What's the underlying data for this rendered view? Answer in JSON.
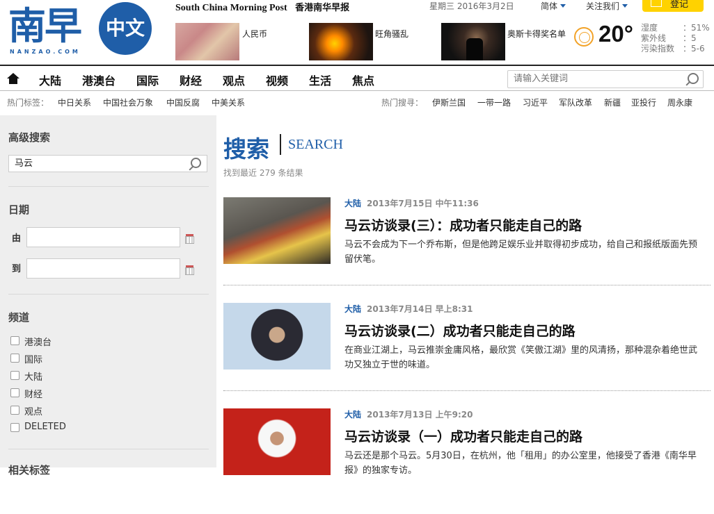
{
  "header": {
    "logo_text": "南早",
    "logo_circle": "中文",
    "logo_sub": "NANZAO.COM",
    "scmp_en": "South China Morning Post",
    "scmp_cn": "香港南华早报",
    "date": "星期三 2016年3月2日",
    "lang": "简体",
    "follow": "关注我们",
    "login": "登记",
    "thumbs": [
      {
        "label": "人民币"
      },
      {
        "label": "旺角骚乱"
      },
      {
        "label": "奥斯卡得奖名单"
      }
    ],
    "weather": {
      "temp": "20°",
      "rows": [
        {
          "k": "湿度",
          "v": "：51%"
        },
        {
          "k": "紫外线",
          "v": "：5"
        },
        {
          "k": "污染指数",
          "v": "：5-6"
        }
      ]
    }
  },
  "nav": {
    "items": [
      "大陆",
      "港澳台",
      "国际",
      "财经",
      "观点",
      "视频",
      "生活",
      "焦点"
    ],
    "search_placeholder": "请输入关键词"
  },
  "hot": {
    "tags_label": "热门标签：",
    "tags": [
      "中日关系",
      "中国社会万象",
      "中国反腐",
      "中美关系"
    ],
    "search_label": "热门搜寻：",
    "searches": [
      "伊斯兰国",
      "一带一路",
      "习近平",
      "军队改革",
      "新疆",
      "亚投行",
      "周永康"
    ]
  },
  "sidebar": {
    "adv_title": "高级搜索",
    "query": "马云",
    "date_title": "日期",
    "from_label": "由",
    "to_label": "到",
    "channel_title": "频道",
    "channels": [
      "港澳台",
      "国际",
      "大陆",
      "财经",
      "观点",
      "DELETED"
    ],
    "next_title": "相关标签"
  },
  "main": {
    "title": "搜索",
    "subtitle": "SEARCH",
    "count": "找到最近 279 条结果",
    "articles": [
      {
        "channel": "大陆",
        "date": "2013年7月15日 中午11:36",
        "title": "马云访谈录(三）：成功者只能走自己的路",
        "desc": "马云不会成为下一个乔布斯，但是他跨足娱乐业并取得初步成功，给自己和报纸版面先预留伏笔。"
      },
      {
        "channel": "大陆",
        "date": "2013年7月14日 早上8:31",
        "title": "马云访谈录(二）成功者只能走自己的路",
        "desc": "在商业江湖上，马云推崇金庸风格，最欣赏《笑傲江湖》里的风清扬，那种混杂着绝世武功又独立于世的味道。"
      },
      {
        "channel": "大陆",
        "date": "2013年7月13日 上午9:20",
        "title": "马云访谈录（一）成功者只能走自己的路",
        "desc": "马云还是那个马云。5月30日，在杭州，他「租用」的办公室里，他接受了香港《南华早报》的独家专访。"
      }
    ]
  },
  "colors": {
    "brand": "#1f5ea8",
    "login": "#ffd200"
  }
}
